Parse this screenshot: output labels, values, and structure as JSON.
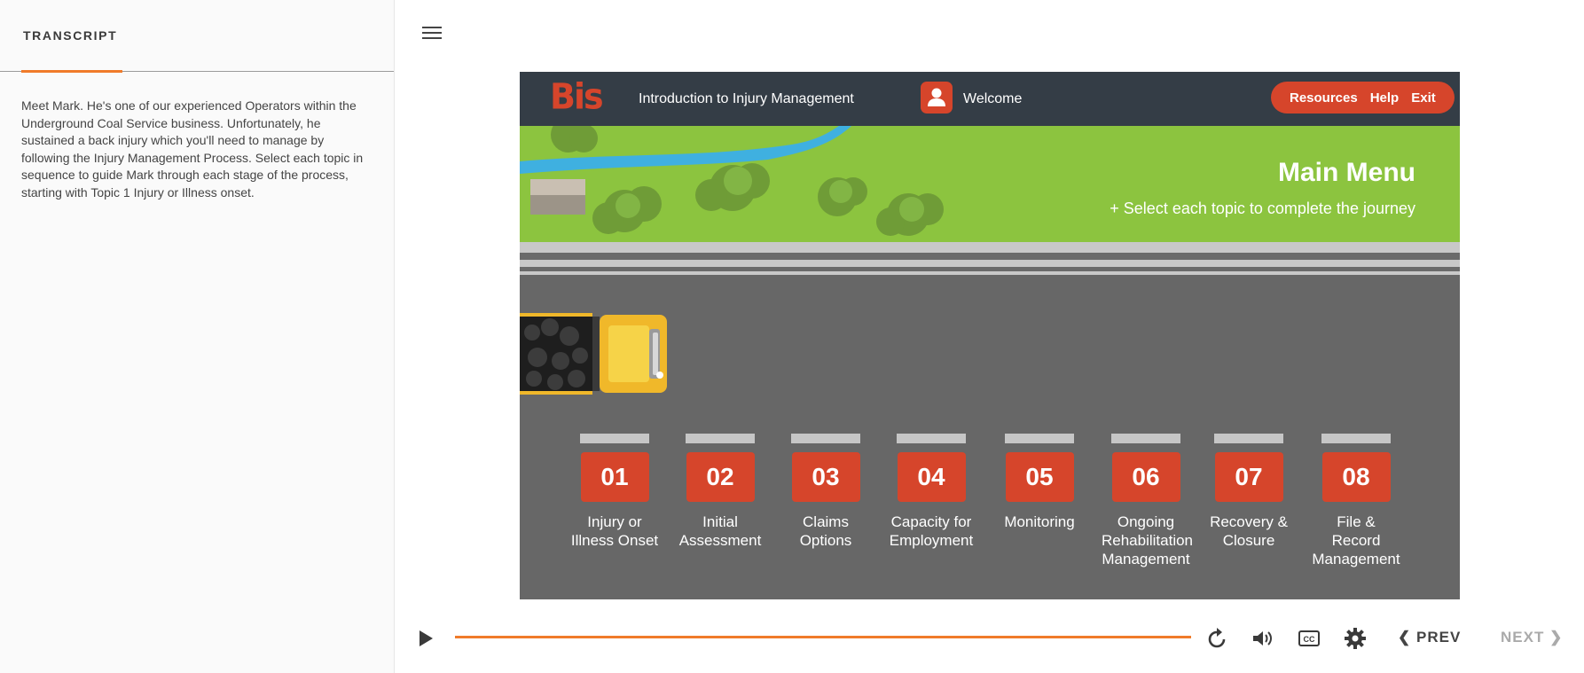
{
  "sidebar": {
    "title": "TRANSCRIPT",
    "text": "Meet Mark. He's one of our experienced Operators within the Underground Coal Service business. Unfortunately, he sustained a back injury which you'll need to manage by following the Injury Management Process. Select each topic in sequence to guide Mark through each stage of the process, starting with Topic 1 Injury or Illness onset."
  },
  "slide": {
    "logo": "Bis",
    "course_title": "Introduction to Injury Management",
    "welcome": "Welcome",
    "actions": [
      "Resources",
      "Help",
      "Exit"
    ],
    "menu_title": "Main Menu",
    "menu_subtitle": "+ Select each topic to complete the journey",
    "topics": [
      {
        "num": "01",
        "label": "Injury or Illness Onset"
      },
      {
        "num": "02",
        "label": "Initial Assessment"
      },
      {
        "num": "03",
        "label": "Claims Options"
      },
      {
        "num": "04",
        "label": "Capacity for Employment"
      },
      {
        "num": "05",
        "label": "Monitoring"
      },
      {
        "num": "06",
        "label": "Ongoing Rehabilitation Management"
      },
      {
        "num": "07",
        "label": "Recovery & Closure"
      },
      {
        "num": "08",
        "label": "File & Record Management"
      }
    ]
  },
  "player": {
    "prev_label": "PREV",
    "next_label": "NEXT",
    "icons": [
      "play-icon",
      "replay-icon",
      "volume-icon",
      "closed-captions-icon",
      "gear-icon"
    ]
  },
  "colors": {
    "accent": "#d6452b",
    "progress": "#f07b2a",
    "topbar": "#343d46",
    "grass": "#8cc43f",
    "road": "#676767"
  }
}
